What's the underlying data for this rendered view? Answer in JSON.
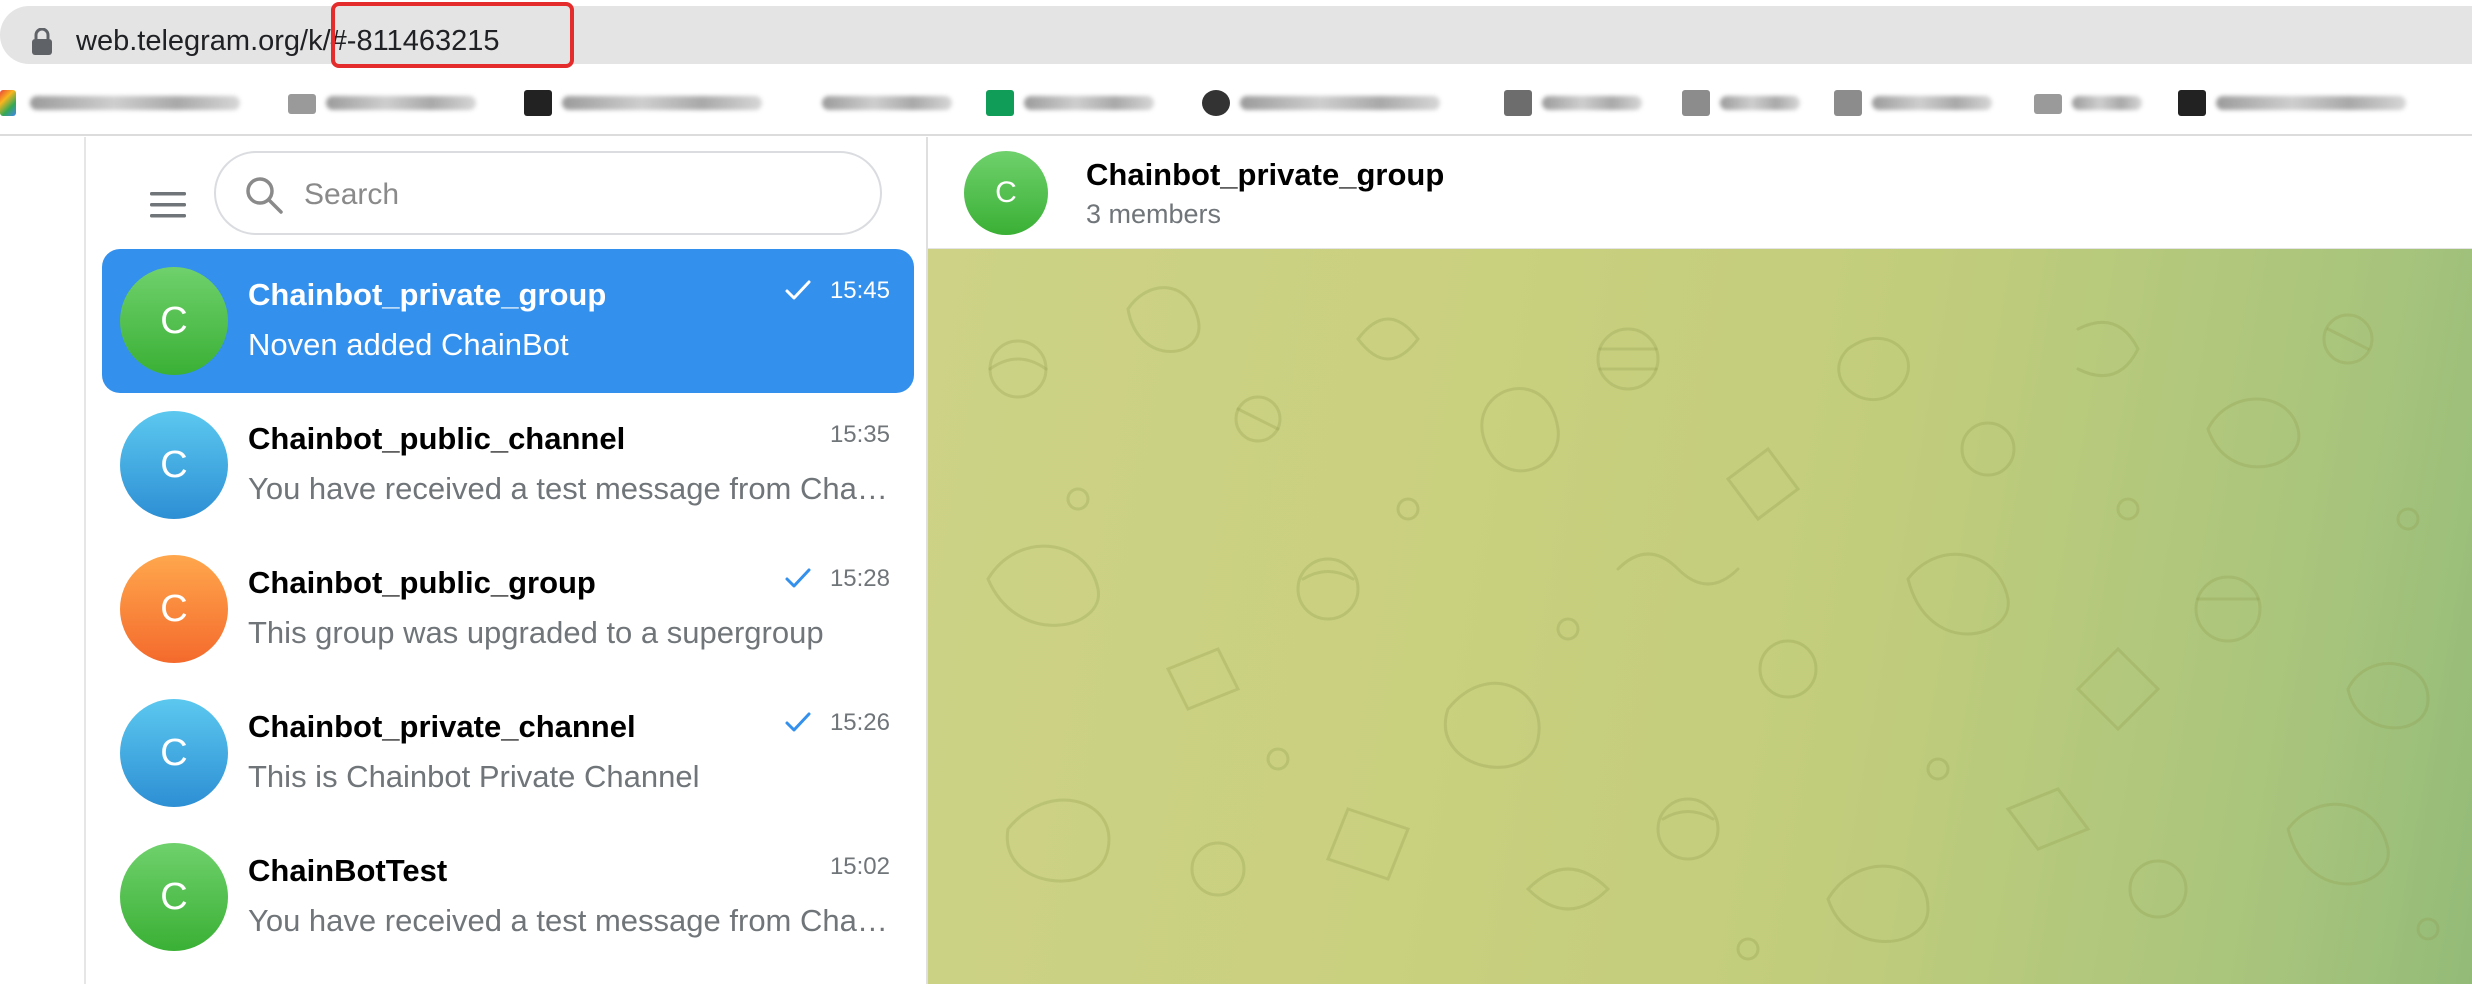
{
  "browser": {
    "url_prefix": "web.telegram.org/k/",
    "url_hash": "#-811463215"
  },
  "sidebar": {
    "search_placeholder": "Search",
    "chats": [
      {
        "name": "Chainbot_private_group",
        "preview": "Noven added ChainBot",
        "time": "15:45",
        "avatar_letter": "C",
        "avatar_color_top": "#6fd16c",
        "avatar_color_bottom": "#3ab035",
        "read": true,
        "active": true
      },
      {
        "name": "Chainbot_public_channel",
        "preview": "You have received a test message from ChainBot",
        "time": "15:35",
        "avatar_letter": "C",
        "avatar_color_top": "#5cc8ef",
        "avatar_color_bottom": "#2d8fd4",
        "read": false,
        "active": false
      },
      {
        "name": "Chainbot_public_group",
        "preview": "This group was upgraded to a supergroup",
        "time": "15:28",
        "avatar_letter": "C",
        "avatar_color_top": "#ffa74d",
        "avatar_color_bottom": "#f46a2c",
        "read": true,
        "active": false
      },
      {
        "name": "Chainbot_private_channel",
        "preview": "This is Chainbot Private Channel",
        "time": "15:26",
        "avatar_letter": "C",
        "avatar_color_top": "#5cc8ef",
        "avatar_color_bottom": "#2d8fd4",
        "read": true,
        "active": false
      },
      {
        "name": "ChainBotTest",
        "preview": "You have received a test message from ChainBot",
        "time": "15:02",
        "avatar_letter": "C",
        "avatar_color_top": "#6fd16c",
        "avatar_color_bottom": "#3ab035",
        "read": false,
        "active": false
      }
    ]
  },
  "chat": {
    "title": "Chainbot_private_group",
    "subtitle": "3 members",
    "avatar_letter": "C"
  },
  "colors": {
    "accent": "#3390ec",
    "highlight_box": "#e52c2c",
    "read_check": "#3390ec"
  }
}
